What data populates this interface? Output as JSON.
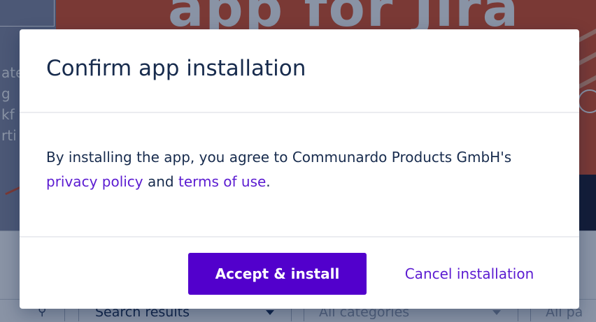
{
  "background": {
    "banner_title": "app for Jira",
    "left_text": [
      "ate",
      "g",
      "kf",
      "rti"
    ],
    "filter_bar": {
      "results_select": "Search results",
      "categories_select": "All categories",
      "partial_select": "All pa"
    }
  },
  "dialog": {
    "title": "Confirm app installation",
    "body": {
      "text_before": "By installing the app, you agree to Communardo Products GmbH's ",
      "privacy_link": "privacy policy",
      "text_middle": " and ",
      "terms_link": "terms of use",
      "text_after": "."
    },
    "primary_button": "Accept & install",
    "cancel_button": "Cancel installation"
  },
  "colors": {
    "primary": "#5200cc",
    "link": "#5b1bd1",
    "banner_orange": "#e2542a",
    "text": "#172b4d"
  },
  "icons": {
    "search": "search-icon",
    "dropdown": "chevron-down-icon"
  }
}
